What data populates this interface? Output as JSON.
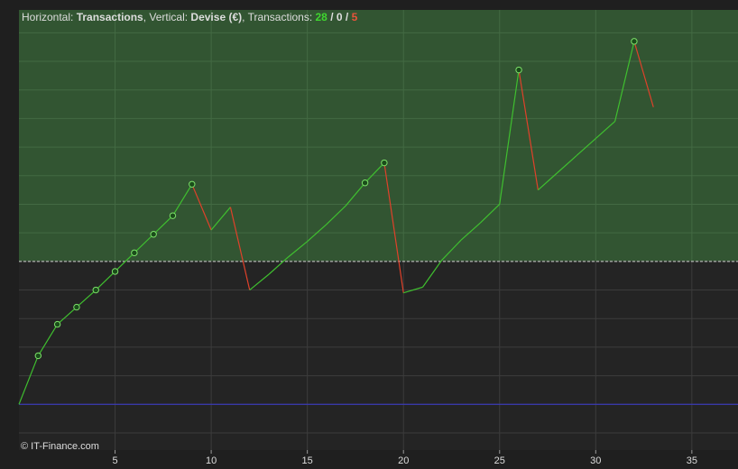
{
  "header": {
    "horizontal_label": "Horizontal: ",
    "horizontal_value": "Transactions",
    "vertical_label": ", Vertical: ",
    "vertical_value": "Devise (€)",
    "transactions_label": ", Transactions: ",
    "wins": "28",
    "sep1": " / ",
    "neutral": "0",
    "sep2": " / ",
    "losses": "5"
  },
  "footer": {
    "copyright": "© IT-Finance.com"
  },
  "colors": {
    "background": "#242424",
    "gain_region": "#325532",
    "grid": "#3c3c3c",
    "gain_grid": "#436a43",
    "up_line": "#3fbf2f",
    "down_line": "#e0412a",
    "marker_fill": "#1a4d1a",
    "marker_stroke": "#7de06a",
    "baseline": "#3a3ad0",
    "reference": "#cfcfcf",
    "text": "#dddddd",
    "wins_color": "#3fd62f",
    "losses_color": "#e8533a"
  },
  "chart_data": {
    "type": "line",
    "title": "",
    "xlabel": "",
    "ylabel": "",
    "x_ticks": [
      5,
      10,
      15,
      20,
      25,
      30,
      35
    ],
    "xlim": [
      0,
      37.4
    ],
    "ylim": [
      -16,
      138
    ],
    "y_grid_step": 10,
    "grid": true,
    "reference_y": 50,
    "baseline_y": 0,
    "points": [
      {
        "x": 0,
        "y": 0
      },
      {
        "x": 1,
        "y": 17
      },
      {
        "x": 2,
        "y": 28
      },
      {
        "x": 3,
        "y": 34
      },
      {
        "x": 4,
        "y": 40
      },
      {
        "x": 5,
        "y": 46.5
      },
      {
        "x": 6,
        "y": 53
      },
      {
        "x": 7,
        "y": 59.5
      },
      {
        "x": 8,
        "y": 66
      },
      {
        "x": 9,
        "y": 77
      },
      {
        "x": 10,
        "y": 61
      },
      {
        "x": 11,
        "y": 69
      },
      {
        "x": 12,
        "y": 40
      },
      {
        "x": 13,
        "y": 45.5
      },
      {
        "x": 14,
        "y": 51.5
      },
      {
        "x": 15,
        "y": 57
      },
      {
        "x": 16,
        "y": 63
      },
      {
        "x": 17,
        "y": 69.5
      },
      {
        "x": 18,
        "y": 77.5
      },
      {
        "x": 19,
        "y": 84.5
      },
      {
        "x": 20,
        "y": 39
      },
      {
        "x": 21,
        "y": 41
      },
      {
        "x": 22,
        "y": 50.5
      },
      {
        "x": 23,
        "y": 57.5
      },
      {
        "x": 24,
        "y": 63.5
      },
      {
        "x": 25,
        "y": 70
      },
      {
        "x": 26,
        "y": 117
      },
      {
        "x": 27,
        "y": 75
      },
      {
        "x": 28,
        "y": 81
      },
      {
        "x": 29,
        "y": 87
      },
      {
        "x": 30,
        "y": 93
      },
      {
        "x": 31,
        "y": 99
      },
      {
        "x": 32,
        "y": 127
      },
      {
        "x": 33,
        "y": 104
      }
    ],
    "marker_x": [
      1,
      2,
      3,
      4,
      5,
      6,
      7,
      8,
      9,
      18,
      19,
      26,
      32
    ]
  }
}
